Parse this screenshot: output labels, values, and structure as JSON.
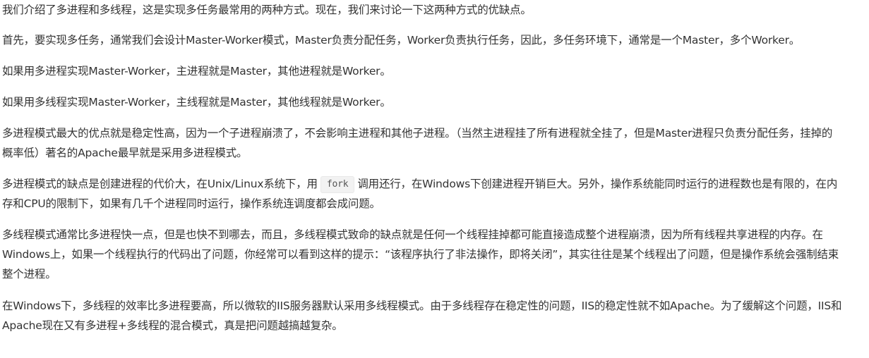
{
  "paragraphs": {
    "p1": "我们介绍了多进程和多线程，这是实现多任务最常用的两种方式。现在，我们来讨论一下这两种方式的优缺点。",
    "p2": "首先，要实现多任务，通常我们会设计Master-Worker模式，Master负责分配任务，Worker负责执行任务，因此，多任务环境下，通常是一个Master，多个Worker。",
    "p3": "如果用多进程实现Master-Worker，主进程就是Master，其他进程就是Worker。",
    "p4": "如果用多线程实现Master-Worker，主线程就是Master，其他线程就是Worker。",
    "p5": "多进程模式最大的优点就是稳定性高，因为一个子进程崩溃了，不会影响主进程和其他子进程。（当然主进程挂了所有进程就全挂了，但是Master进程只负责分配任务，挂掉的概率低）著名的Apache最早就是采用多进程模式。",
    "p6_before": "多进程模式的缺点是创建进程的代价大，在Unix/Linux系统下，用",
    "p6_code": "fork",
    "p6_after": "调用还行，在Windows下创建进程开销巨大。另外，操作系统能同时运行的进程数也是有限的，在内存和CPU的限制下，如果有几千个进程同时运行，操作系统连调度都会成问题。",
    "p7": "多线程模式通常比多进程快一点，但是也快不到哪去，而且，多线程模式致命的缺点就是任何一个线程挂掉都可能直接造成整个进程崩溃，因为所有线程共享进程的内存。在Windows上，如果一个线程执行的代码出了问题，你经常可以看到这样的提示：“该程序执行了非法操作，即将关闭”，其实往往是某个线程出了问题，但是操作系统会强制结束整个进程。",
    "p8": "在Windows下，多线程的效率比多进程要高，所以微软的IIS服务器默认采用多线程模式。由于多线程存在稳定性的问题，IIS的稳定性就不如Apache。为了缓解这个问题，IIS和Apache现在又有多进程+多线程的混合模式，真是把问题越搞越复杂。"
  }
}
